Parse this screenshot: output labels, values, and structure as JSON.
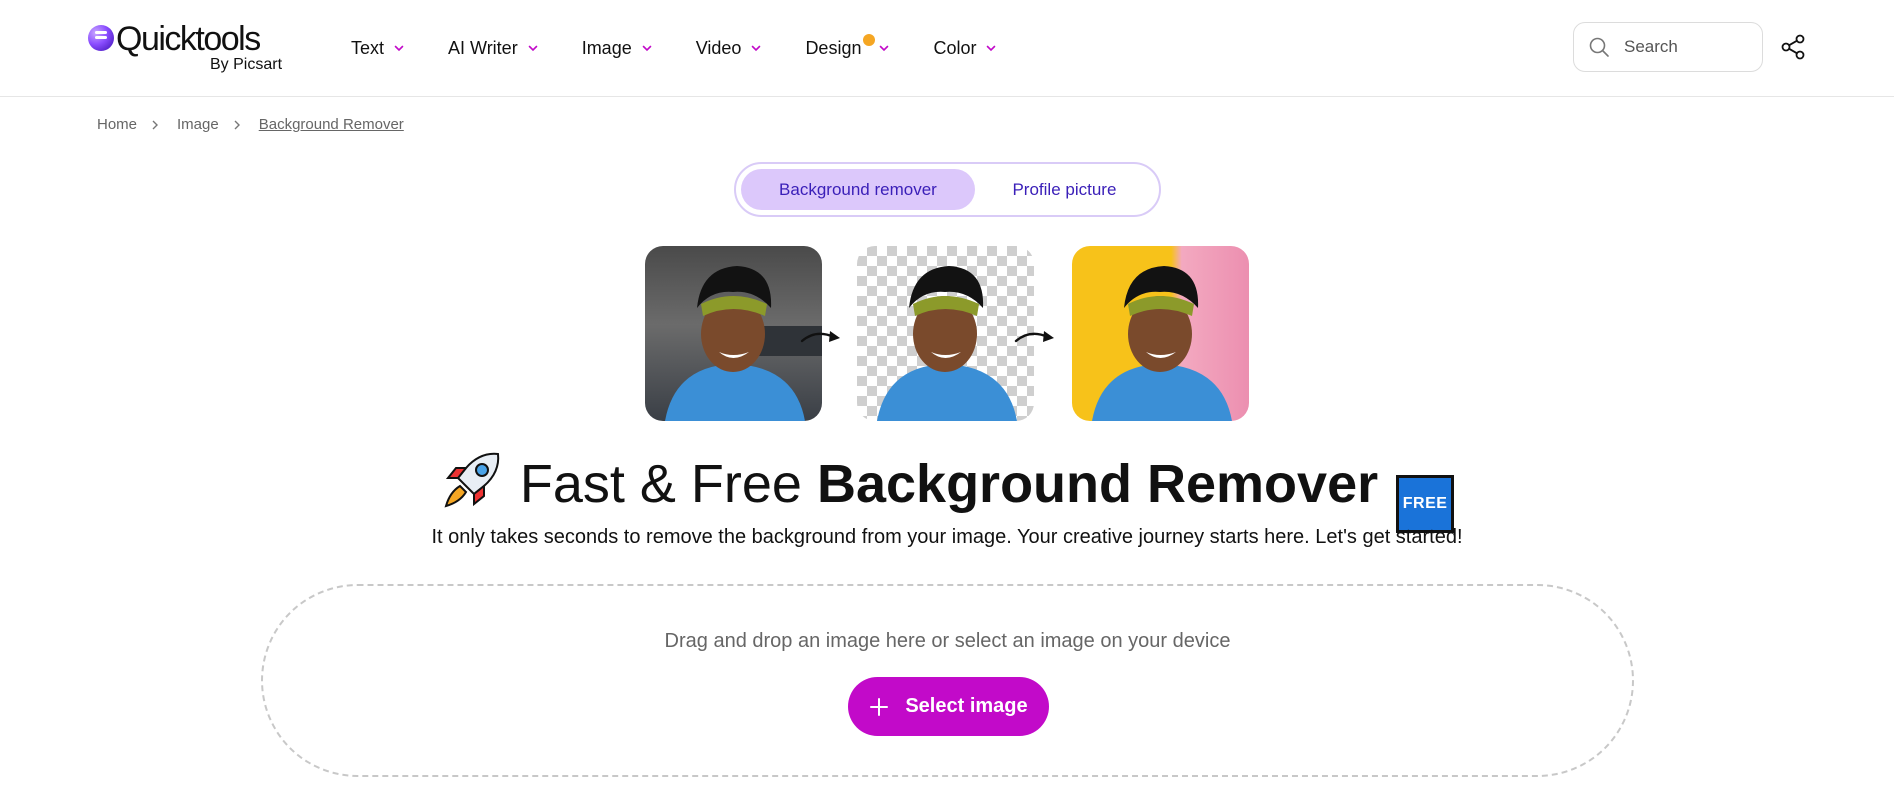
{
  "brand": {
    "name": "Quicktools",
    "byline": "By Picsart"
  },
  "nav": {
    "items": [
      {
        "label": "Text"
      },
      {
        "label": "AI Writer"
      },
      {
        "label": "Image"
      },
      {
        "label": "Video"
      },
      {
        "label": "Design",
        "badge": "new-dot"
      },
      {
        "label": "Color"
      }
    ]
  },
  "search": {
    "placeholder": "Search"
  },
  "breadcrumb": {
    "home": "Home",
    "section": "Image",
    "current": "Background Remover"
  },
  "tabs": [
    {
      "label": "Background remover",
      "active": true
    },
    {
      "label": "Profile picture",
      "active": false
    }
  ],
  "hero": {
    "title_regular": "Fast & Free ",
    "title_bold": "Background Remover",
    "badge": "FREE",
    "subtitle": "It only takes seconds to remove the background from your image. Your creative journey starts here. Let's get started!"
  },
  "upload": {
    "instruction": "Drag and drop an image here or select an image on your device",
    "button_label": "Select image"
  },
  "colors": {
    "accent": "#c20ac9",
    "tab_active_bg": "#dcc8fb",
    "tab_text": "#3a1fb8",
    "badge_dot": "#f5a623",
    "free_badge": "#1a73d9"
  }
}
